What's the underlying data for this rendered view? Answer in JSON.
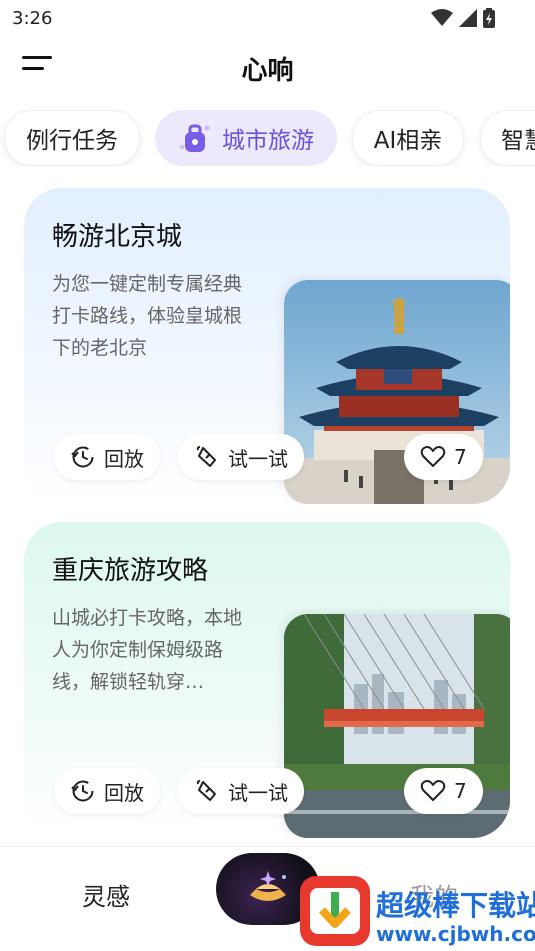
{
  "status_bar": {
    "time": "3:26"
  },
  "header": {
    "title": "心响"
  },
  "tabs": [
    {
      "label": "例行任务"
    },
    {
      "label": "城市旅游",
      "active": true
    },
    {
      "label": "AI相亲"
    },
    {
      "label": "智慧"
    }
  ],
  "cards": [
    {
      "title": "畅游北京城",
      "description": "为您一键定制专属经典打卡路线，体验皇城根下的老北京",
      "replay_label": "回放",
      "try_label": "试一试",
      "likes": "7"
    },
    {
      "title": "重庆旅游攻略",
      "description": "山城必打卡攻略，本地人为你定制保姆级路线，解锁轻轨穿…",
      "replay_label": "回放",
      "try_label": "试一试",
      "likes": "7"
    }
  ],
  "bottom_nav": {
    "left_label": "灵感",
    "right_label": "我的"
  },
  "watermark": {
    "text": "超级棒下载站",
    "url": "www.cjbwh.com"
  },
  "colors": {
    "accent": "#6a52d9",
    "active_tab_bg": "#ece9fd",
    "watermark_blue": "#1e6fd9"
  }
}
